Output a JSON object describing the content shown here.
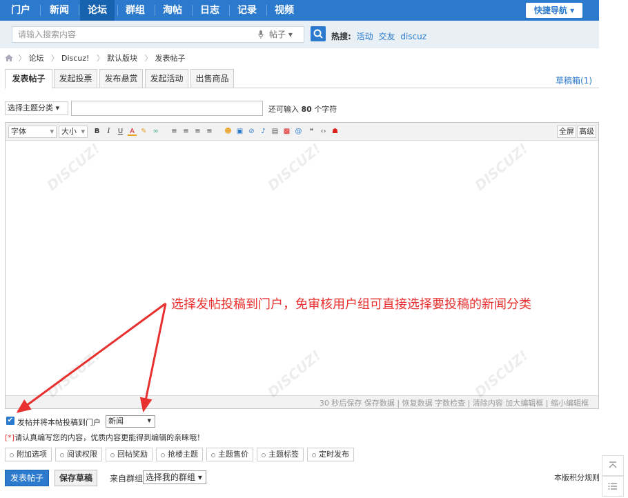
{
  "nav": {
    "items": [
      "门户",
      "新闻",
      "论坛",
      "群组",
      "淘帖",
      "日志",
      "记录",
      "视频"
    ],
    "active_index": 2,
    "quick_nav": "快捷导航 ▾"
  },
  "search": {
    "placeholder": "请输入搜索内容",
    "type": "帖子 ▾",
    "hot_label": "热搜:",
    "hot_links": [
      "活动",
      "交友",
      "discuz"
    ]
  },
  "breadcrumb": [
    "论坛",
    "Discuz!",
    "默认版块",
    "发表帖子"
  ],
  "tabs": [
    "发表帖子",
    "发起投票",
    "发布悬赏",
    "发起活动",
    "出售商品"
  ],
  "drafts": "草稿箱(1)",
  "subject": {
    "type_select": "选择主题分类 ▾",
    "counter_prefix": "还可输入",
    "counter_value": "80",
    "counter_suffix": "个字符"
  },
  "toolbar": {
    "font": "字体",
    "size": "大小",
    "fullscreen": "全屏",
    "advanced": "高级"
  },
  "statusbar": "30 秒后保存 保存数据 | 恢复数据   字数检查 | 清除内容   加大编辑框 | 缩小编辑框",
  "annotation": "选择发帖投稿到门户，免审核用户组可直接选择要投稿的新闻分类",
  "portal": {
    "label": "发帖并将本帖投稿到门户",
    "category": "新闻"
  },
  "tip": {
    "required": "[*]",
    "text": "请认真编写您的内容，优质内容更能得到编辑的亲睐哦！"
  },
  "options": [
    "附加选项",
    "阅读权限",
    "回帖奖励",
    "抢楼主题",
    "主题售价",
    "主题标签",
    "定时发布"
  ],
  "actions": {
    "publish": "发表帖子",
    "save_draft": "保存草稿",
    "group_label": "来自群组:",
    "group_select": "选择我的群组 ▾",
    "rules": "本版积分规则"
  },
  "colors": {
    "accent": "#2b7acd",
    "annotation": "#e8302f"
  }
}
